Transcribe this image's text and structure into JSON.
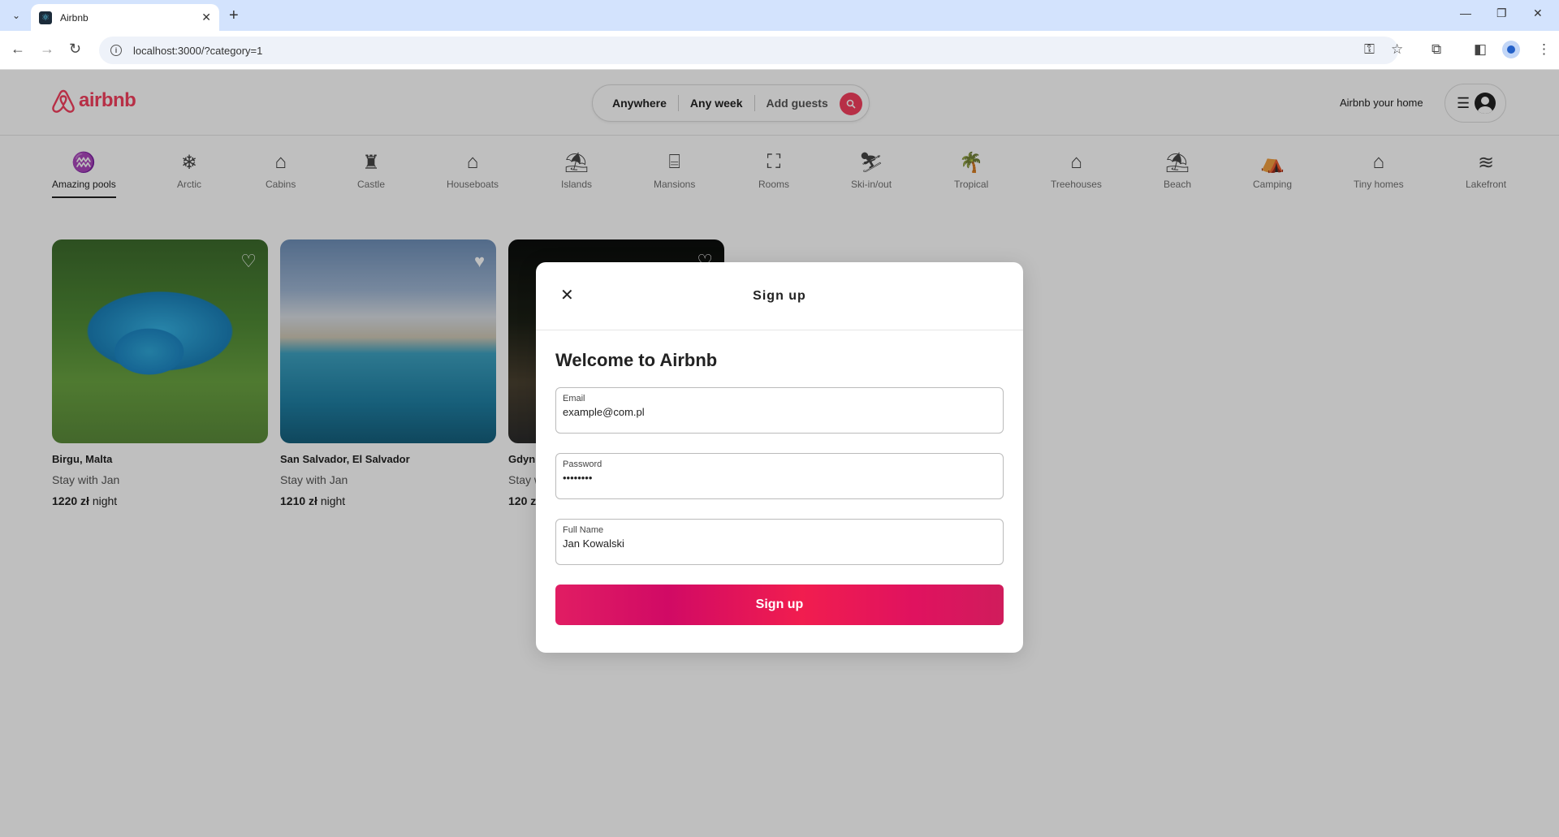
{
  "browser": {
    "tab_title": "Airbnb",
    "url": "localhost:3000/?category=1"
  },
  "header": {
    "logo_text": "airbnb",
    "search": {
      "anywhere": "Anywhere",
      "any_week": "Any week",
      "add_guests": "Add guests"
    },
    "host_link": "Airbnb your home"
  },
  "categories": [
    {
      "label": "Amazing pools",
      "icon": "pool-icon"
    },
    {
      "label": "Arctic",
      "icon": "snowflake-icon"
    },
    {
      "label": "Cabins",
      "icon": "cabin-icon"
    },
    {
      "label": "Castle",
      "icon": "castle-icon"
    },
    {
      "label": "Houseboats",
      "icon": "houseboat-icon"
    },
    {
      "label": "Islands",
      "icon": "island-icon"
    },
    {
      "label": "Mansions",
      "icon": "mansion-icon"
    },
    {
      "label": "Rooms",
      "icon": "bed-icon"
    },
    {
      "label": "Ski-in/out",
      "icon": "skier-icon"
    },
    {
      "label": "Tropical",
      "icon": "palm-icon"
    },
    {
      "label": "Treehouses",
      "icon": "treehouse-icon"
    },
    {
      "label": "Beach",
      "icon": "umbrella-icon"
    },
    {
      "label": "Camping",
      "icon": "tent-icon"
    },
    {
      "label": "Tiny homes",
      "icon": "tiny-home-icon"
    },
    {
      "label": "Lakefront",
      "icon": "lake-icon"
    }
  ],
  "listings": [
    {
      "location": "Birgu, Malta",
      "host": "Stay with Jan",
      "price": "1220 zł",
      "unit": "night"
    },
    {
      "location": "San Salvador, El Salvador",
      "host": "Stay with Jan",
      "price": "1210 zł",
      "unit": "night"
    },
    {
      "location": "Gdyni",
      "host": "Stay w",
      "price": "120 z",
      "unit": ""
    }
  ],
  "modal": {
    "title": "Sign up",
    "welcome": "Welcome to Airbnb",
    "email_label": "Email",
    "email_value": "example@com.pl",
    "password_label": "Password",
    "password_value": "••••••••",
    "fullname_label": "Full Name",
    "fullname_value": "Jan Kowalski",
    "submit_label": "Sign up"
  },
  "colors": {
    "brand": "#f43f5e",
    "button_gradient_start": "#e11d63"
  }
}
